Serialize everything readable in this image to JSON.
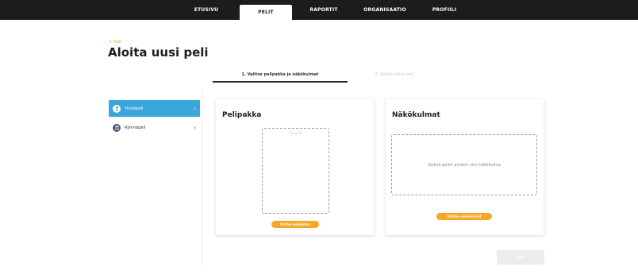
{
  "nav": {
    "items": [
      {
        "label": "ETUSIVU"
      },
      {
        "label": "PELIT"
      },
      {
        "label": "RAPORTIT"
      },
      {
        "label": "ORGANISAATIO"
      },
      {
        "label": "PROFIILI"
      }
    ],
    "active": "PELIT"
  },
  "header": {
    "back_label": "< Pelit",
    "title": "Aloita uusi peli"
  },
  "steps": [
    {
      "label": "1. Valitse pelipakka ja näkökulmat"
    },
    {
      "label": "2. Valitse pelin nimi"
    }
  ],
  "sidebar": {
    "items": [
      {
        "label": "Yksilöpeli",
        "icon": "person-icon"
      },
      {
        "label": "Ryhmäpeli",
        "icon": "group-icon"
      }
    ]
  },
  "cards": {
    "deck": {
      "title": "Pelipakka",
      "button": "Valitse pelipakka"
    },
    "perspectives": {
      "title": "Näkökulmat",
      "hint": "Valitse peliin ainakin yksi näkökulma",
      "button": "Valitse näkökulmat"
    }
  },
  "footer": {
    "next_label": "Jatka"
  },
  "colors": {
    "accent": "#f5a623",
    "active_blue": "#3aa6dc",
    "topbar": "#1c1c1c"
  }
}
